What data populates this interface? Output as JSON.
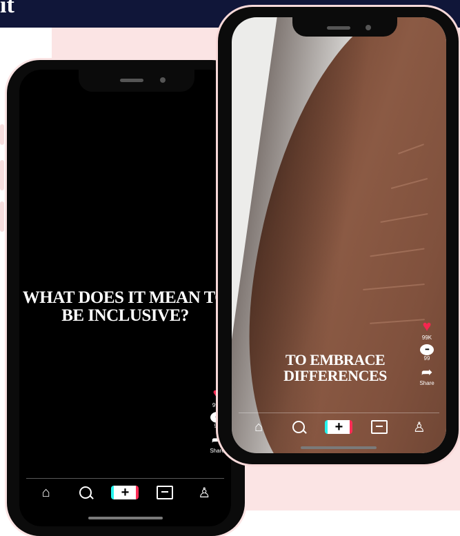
{
  "header": {
    "title_fragment": "it"
  },
  "left_phone": {
    "caption": "WHAT DOES IT MEAN TO BE INCLUSIVE?",
    "likes": "99K",
    "comments": "99",
    "share_label": "Share"
  },
  "right_phone": {
    "caption": "TO EMBRACE DIFFERENCES",
    "likes": "99K",
    "comments": "99",
    "share_label": "Share"
  },
  "tabbar_icons": [
    "home-icon",
    "search-icon",
    "create-icon",
    "inbox-icon",
    "profile-icon"
  ],
  "colors": {
    "banner": "#101639",
    "background_pink": "#fbe4e4",
    "heart": "#f4264f",
    "plus_cyan": "#25f4ee",
    "plus_red": "#fe2c55"
  }
}
